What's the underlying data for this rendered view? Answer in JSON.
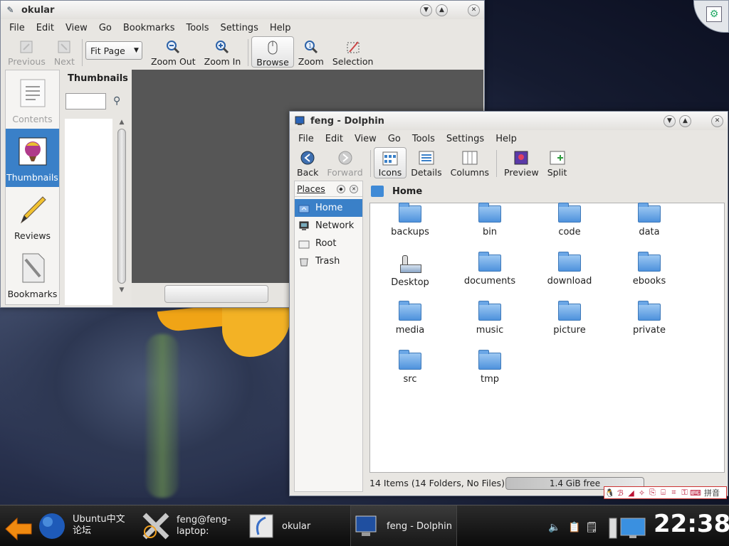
{
  "okular": {
    "title": "okular",
    "menu": [
      "File",
      "Edit",
      "View",
      "Go",
      "Bookmarks",
      "Tools",
      "Settings",
      "Help"
    ],
    "toolbar": {
      "previous": "Previous",
      "next": "Next",
      "fit_page": "Fit Page",
      "zoom_out": "Zoom Out",
      "zoom_in": "Zoom In",
      "browse": "Browse",
      "zoom": "Zoom",
      "selection": "Selection"
    },
    "sidebar": [
      "Contents",
      "Thumbnails",
      "Reviews",
      "Bookmarks"
    ],
    "thumbnails_title": "Thumbnails"
  },
  "dolphin": {
    "title": "feng - Dolphin",
    "menu": [
      "File",
      "Edit",
      "View",
      "Go",
      "Tools",
      "Settings",
      "Help"
    ],
    "toolbar": {
      "back": "Back",
      "forward": "Forward",
      "icons": "Icons",
      "details": "Details",
      "columns": "Columns",
      "preview": "Preview",
      "split": "Split"
    },
    "places_title": "Places",
    "places": [
      "Home",
      "Network",
      "Root",
      "Trash"
    ],
    "location": "Home",
    "files": [
      "backups",
      "bin",
      "code",
      "data",
      "Desktop",
      "documents",
      "download",
      "ebooks",
      "media",
      "music",
      "picture",
      "private",
      "src",
      "tmp"
    ],
    "status": "14 Items (14 Folders, No Files)",
    "free_space": "1.4 GiB free"
  },
  "panel": {
    "tasks": [
      "Ubuntu中文 论坛",
      "feng@feng-laptop:",
      "okular",
      "feng - Dolphin"
    ],
    "clock": "22:38",
    "ime": "拼音"
  }
}
